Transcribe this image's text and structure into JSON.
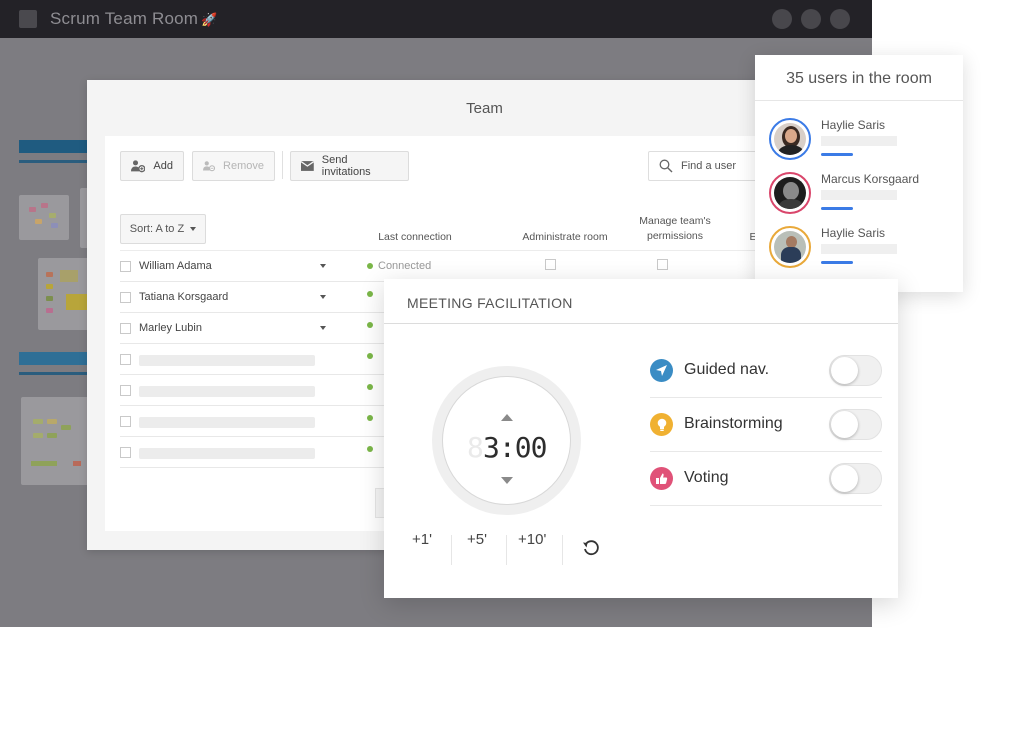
{
  "window": {
    "title": "Scrum Team Room",
    "title_emoji": "🚀"
  },
  "team_dialog": {
    "title": "Team",
    "toolbar": {
      "add_label": "Add",
      "remove_label": "Remove",
      "send_invitations_label": "Send invitations",
      "search_placeholder": "Find a user"
    },
    "sort_label": "Sort: A to Z",
    "columns": {
      "last_connection": "Last connection",
      "administrate_room": "Administrate room",
      "manage_permissions_line1": "Manage team's",
      "manage_permissions_line2": "permissions",
      "truncated": "E"
    },
    "members": [
      {
        "name": "William Adama",
        "status": "Connected"
      },
      {
        "name": "Tatiana Korsgaard",
        "status": ""
      },
      {
        "name": "Marley Lubin",
        "status": ""
      }
    ]
  },
  "users_panel": {
    "title": "35 users in the room",
    "users": [
      {
        "name": "Haylie Saris",
        "ring_color": "#3b7be6"
      },
      {
        "name": "Marcus Korsgaard",
        "ring_color": "#d9466b"
      },
      {
        "name": "Haylie Saris",
        "ring_color": "#e9a93a"
      }
    ]
  },
  "meeting_facilitation": {
    "title": "MEETING FACILITATION",
    "timer": {
      "ghost_digit": "8",
      "value": "3:00"
    },
    "increments": [
      "+1'",
      "+5'",
      "+10'"
    ],
    "features": [
      {
        "label": "Guided nav.",
        "icon": "navigation-arrow-icon",
        "color": "#3a8cc4",
        "enabled": false
      },
      {
        "label": "Brainstorming",
        "icon": "lightbulb-icon",
        "color": "#f0b132",
        "enabled": false
      },
      {
        "label": "Voting",
        "icon": "thumbs-up-icon",
        "color": "#e05278",
        "enabled": false
      }
    ]
  }
}
